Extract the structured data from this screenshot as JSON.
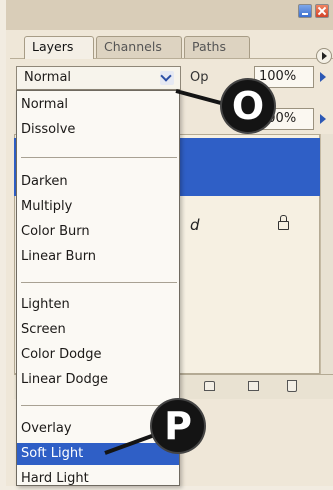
{
  "tabs": [
    "Layers",
    "Channels",
    "Paths"
  ],
  "blend_select": {
    "value": "Normal"
  },
  "opacity": {
    "label": "Op",
    "value": "100%"
  },
  "fill": {
    "value": "100%"
  },
  "layer": {
    "partial_name": "d"
  },
  "blend_menu": {
    "groups": [
      [
        "Normal",
        "Dissolve"
      ],
      [
        "Darken",
        "Multiply",
        "Color Burn",
        "Linear Burn"
      ],
      [
        "Lighten",
        "Screen",
        "Color Dodge",
        "Linear Dodge"
      ],
      [
        "Overlay",
        "Soft Light",
        "Hard Light"
      ]
    ],
    "selected": "Soft Light"
  },
  "callouts": {
    "o": "O",
    "p": "P"
  },
  "colors": {
    "selection": "#2f5fc6",
    "callout": "#141414",
    "panel": "#efe7d8"
  }
}
